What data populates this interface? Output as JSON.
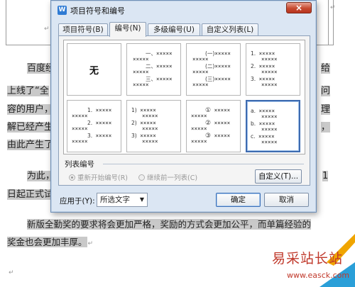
{
  "document": {
    "table_marks": [
      "↵",
      "↵"
    ],
    "lines": [
      {
        "text": "百度经",
        "tail": "给",
        "highlight": true
      },
      {
        "text": "上线了“全",
        "tail": "问",
        "highlight": true
      },
      {
        "text": "容的用户，",
        "tail": "理",
        "highlight": true
      },
      {
        "text": "解已经产生",
        "tail": "，",
        "highlight": true
      },
      {
        "text": "由此产生了",
        "tail": "",
        "highlight": true
      },
      {
        "text": "为此，",
        "tail": "1",
        "highlight": true
      },
      {
        "text": "日起正式试",
        "tail": "",
        "highlight": true
      },
      {
        "text": "新版全勤奖的要求将会更加严格，奖励的方式会更加公平，而单篇经验的",
        "tail": "",
        "highlight": true
      },
      {
        "text": "奖金也会更加丰厚。",
        "tail": "↵",
        "highlight": true
      },
      {
        "text": "↵",
        "tail": "",
        "highlight": false
      }
    ]
  },
  "dialog": {
    "title": "项目符号和编号",
    "app_icon": "W",
    "close_icon": "×",
    "tabs": [
      {
        "label": "项目符号(B)",
        "active": false
      },
      {
        "label": "编号(N)",
        "active": true
      },
      {
        "label": "多级编号(U)",
        "active": false
      },
      {
        "label": "自定义列表(L)",
        "active": false
      }
    ],
    "numbering_styles": [
      {
        "name": "none",
        "none_label": "无"
      },
      {
        "name": "chinese-number",
        "markers": [
          "一、",
          "二、",
          "三、"
        ]
      },
      {
        "name": "chinese-paren",
        "markers": [
          "(一)",
          "(二)",
          "(三)"
        ]
      },
      {
        "name": "arabic-dot",
        "markers": [
          "1.",
          "2.",
          "3."
        ]
      },
      {
        "name": "arabic-dot-indent",
        "markers": [
          "1.",
          "2.",
          "3."
        ]
      },
      {
        "name": "arabic-paren",
        "markers": [
          "1)",
          "2)",
          "3)"
        ]
      },
      {
        "name": "circled",
        "markers": [
          "①",
          "②",
          "③"
        ]
      },
      {
        "name": "alpha-dot",
        "markers": [
          "a.",
          "b.",
          "c."
        ],
        "selected": true
      }
    ],
    "placeholder_x": "×××××",
    "list_numbering": {
      "label": "列表编号",
      "restart": "重新开始编号(R)",
      "continue": "继续前一列表(C)",
      "custom_button": "自定义(T)..."
    },
    "apply_to": {
      "label": "应用于(Y):",
      "value": "所选文字"
    },
    "ok_button": "确定",
    "cancel_button": "取消"
  },
  "watermark": {
    "text": "易采站长站",
    "url": "www.easck.com"
  },
  "colors": {
    "dialog_bg": "#dbe6f3",
    "selection_border": "#3e6bb0",
    "highlight": "#c9c9c9",
    "watermark": "#c0392b"
  }
}
